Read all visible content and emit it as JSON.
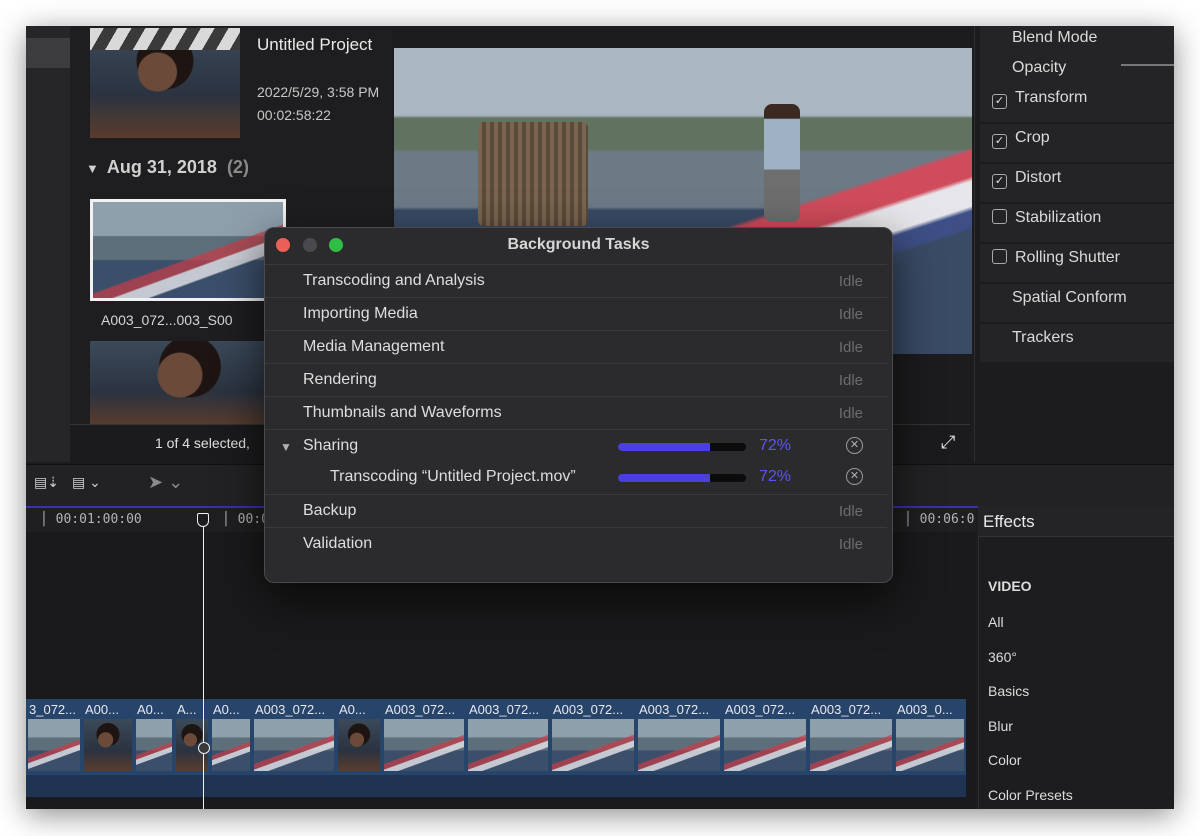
{
  "browser": {
    "project_title": "Untitled Project",
    "project_date": "2022/5/29, 3:58 PM",
    "project_duration": "00:02:58:22",
    "date_group": "Aug 31, 2018",
    "date_group_count": "(2)",
    "selected_clip_name": "A003_072...003_S00",
    "status": "1 of 4 selected,"
  },
  "inspector": {
    "items": [
      {
        "label": "Blend Mode",
        "checkbox": "none"
      },
      {
        "label": "Opacity",
        "checkbox": "none"
      },
      {
        "label": "Transform",
        "checkbox": "checked"
      },
      {
        "label": "Crop",
        "checkbox": "checked"
      },
      {
        "label": "Distort",
        "checkbox": "checked"
      },
      {
        "label": "Stabilization",
        "checkbox": "unchecked"
      },
      {
        "label": "Rolling Shutter",
        "checkbox": "unchecked"
      },
      {
        "label": "Spatial Conform",
        "checkbox": "none"
      },
      {
        "label": "Trackers",
        "checkbox": "none"
      }
    ]
  },
  "timeline": {
    "ruler": [
      "00:01:00:00",
      "00:02",
      "00:06:0"
    ],
    "clips": [
      "3_072...",
      "A00...",
      "A0...",
      "A...",
      "A0...",
      "A003_072...",
      "A0...",
      "A003_072...",
      "A003_072...",
      "A003_072...",
      "A003_072...",
      "A003_072...",
      "A003_072...",
      "A003_0..."
    ]
  },
  "effects": {
    "title": "Effects",
    "section": "VIDEO",
    "items": [
      "All",
      "360°",
      "Basics",
      "Blur",
      "Color",
      "Color Presets"
    ]
  },
  "dialog": {
    "title": "Background Tasks",
    "close_color": "#ec5f56",
    "zoom_color": "#2fbd45",
    "tasks": [
      {
        "label": "Transcoding and Analysis",
        "status": "Idle"
      },
      {
        "label": "Importing Media",
        "status": "Idle"
      },
      {
        "label": "Media Management",
        "status": "Idle"
      },
      {
        "label": "Rendering",
        "status": "Idle"
      },
      {
        "label": "Thumbnails and Waveforms",
        "status": "Idle"
      },
      {
        "label": "Sharing",
        "progress_pct": "72%",
        "progress": 0.72,
        "expanded": true
      },
      {
        "label": "Transcoding “Untitled Project.mov”",
        "progress_pct": "72%",
        "progress": 0.72
      },
      {
        "label": "Backup",
        "status": "Idle"
      },
      {
        "label": "Validation",
        "status": "Idle"
      }
    ]
  },
  "colors": {
    "accent": "#4b3fe0",
    "clip_blue": "#27446a"
  }
}
